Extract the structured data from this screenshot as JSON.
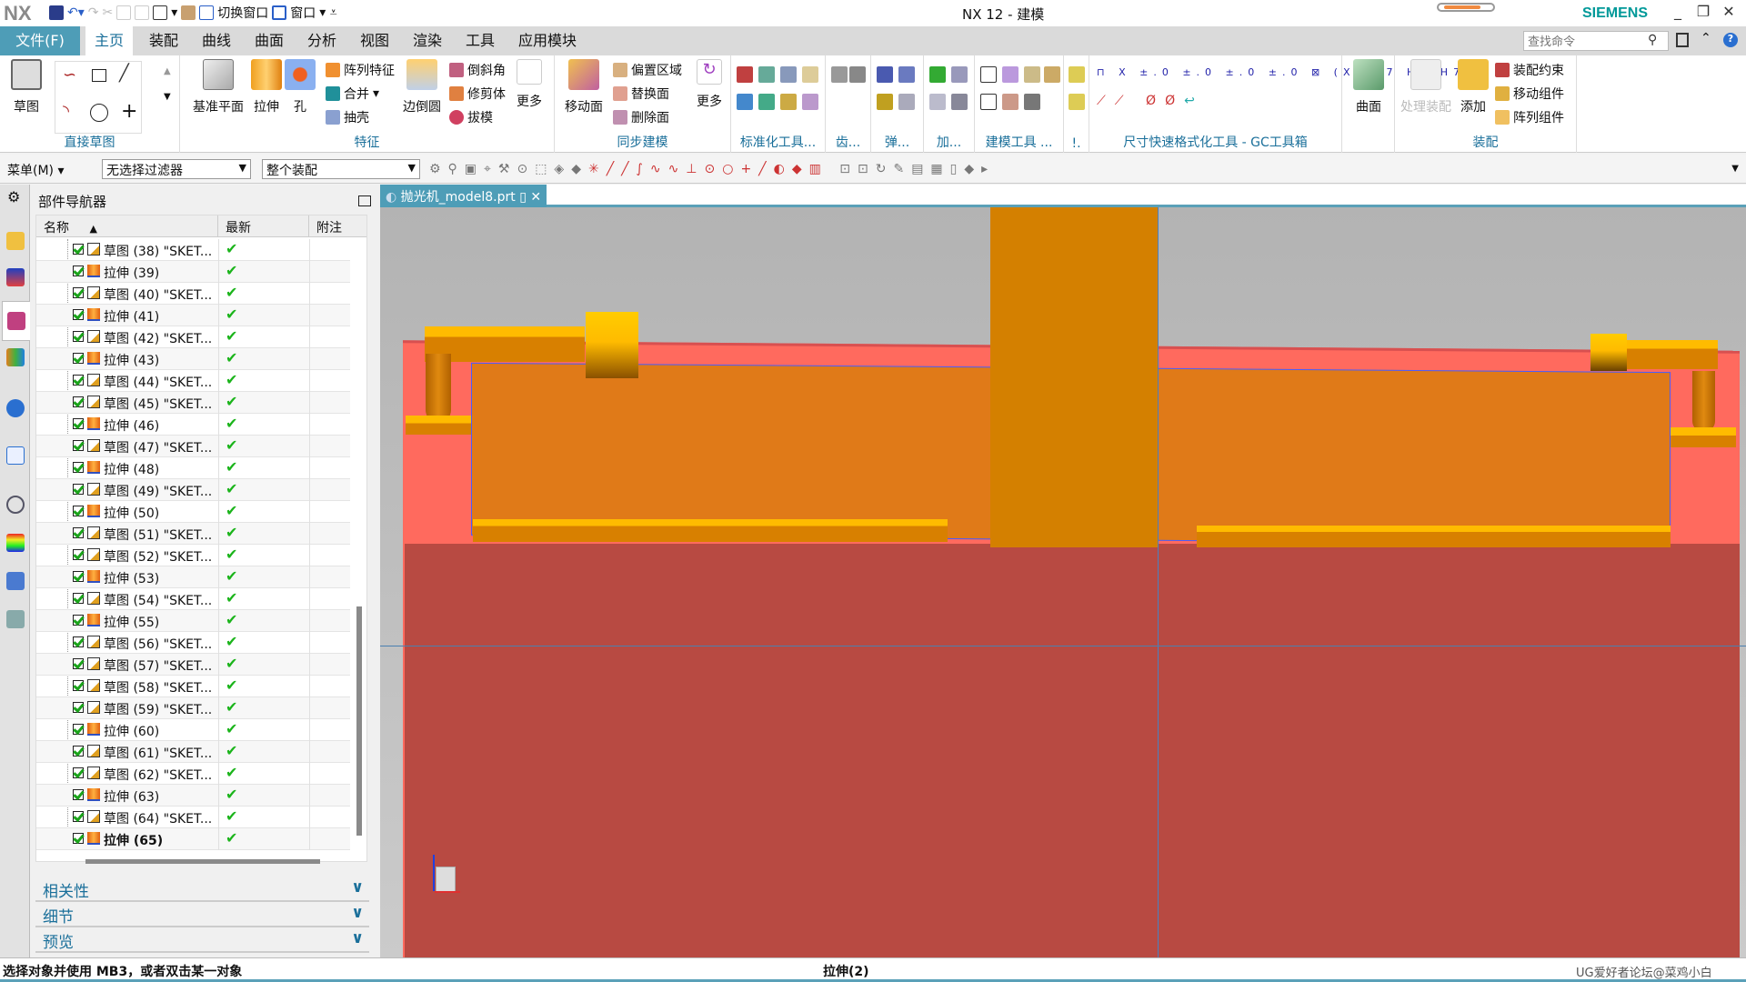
{
  "app": {
    "logo": "NX",
    "title": "NX 12 - 建模",
    "brand": "SIEMENS",
    "switch_window": "切换窗口",
    "window": "窗口"
  },
  "tabs": [
    "文件(F)",
    "主页",
    "装配",
    "曲线",
    "曲面",
    "分析",
    "视图",
    "渲染",
    "工具",
    "应用模块"
  ],
  "active_tab": "主页",
  "search": {
    "placeholder": "查找命令"
  },
  "ribbon": {
    "direct_sketch": {
      "label": "直接草图",
      "sketch": "草图"
    },
    "feature": {
      "label": "特征",
      "datum_plane": "基准平面",
      "extrude": "拉伸",
      "hole": "孔",
      "pattern_feature": "阵列特征",
      "unite": "合并",
      "shell": "抽壳",
      "edge_blend": "边倒圆",
      "chamfer": "倒斜角",
      "trim_body": "修剪体",
      "draft": "拔模",
      "more": "更多"
    },
    "sync": {
      "label": "同步建模",
      "move_face": "移动面",
      "offset_region": "偏置区域",
      "replace_face": "替换面",
      "delete_face": "删除面",
      "more": "更多"
    },
    "std_tools": "标准化工具...",
    "gear": "齿...",
    "spring": "弹...",
    "machining": "加...",
    "modeling_tools": "建模工具 ...",
    "misc": "!.",
    "gc": "尺寸快速格式化工具 - GC工具箱",
    "surface": "曲面",
    "assembly": {
      "label": "装配",
      "process": "处理装配",
      "add": "添加",
      "constraint": "装配约束",
      "move_component": "移动组件",
      "pattern_component": "阵列组件"
    }
  },
  "toolbar2": {
    "menu": "菜单(M)",
    "filter": "无选择过滤器",
    "scope": "整个装配"
  },
  "navigator": {
    "title": "部件导航器",
    "columns": [
      "名称",
      "最新",
      "附注"
    ],
    "rows": [
      {
        "name": "草图 (38) \"SKET...",
        "type": "sketch"
      },
      {
        "name": "拉伸 (39)",
        "type": "extrude"
      },
      {
        "name": "草图 (40) \"SKET...",
        "type": "sketch"
      },
      {
        "name": "拉伸 (41)",
        "type": "extrude"
      },
      {
        "name": "草图 (42) \"SKET...",
        "type": "sketch"
      },
      {
        "name": "拉伸 (43)",
        "type": "extrude"
      },
      {
        "name": "草图 (44) \"SKET...",
        "type": "sketch"
      },
      {
        "name": "草图 (45) \"SKET...",
        "type": "sketch"
      },
      {
        "name": "拉伸 (46)",
        "type": "extrude"
      },
      {
        "name": "草图 (47) \"SKET...",
        "type": "sketch"
      },
      {
        "name": "拉伸 (48)",
        "type": "extrude"
      },
      {
        "name": "草图 (49) \"SKET...",
        "type": "sketch"
      },
      {
        "name": "拉伸 (50)",
        "type": "extrude"
      },
      {
        "name": "草图 (51) \"SKET...",
        "type": "sketch"
      },
      {
        "name": "草图 (52) \"SKET...",
        "type": "sketch"
      },
      {
        "name": "拉伸 (53)",
        "type": "extrude"
      },
      {
        "name": "草图 (54) \"SKET...",
        "type": "sketch"
      },
      {
        "name": "拉伸 (55)",
        "type": "extrude"
      },
      {
        "name": "草图 (56) \"SKET...",
        "type": "sketch"
      },
      {
        "name": "草图 (57) \"SKET...",
        "type": "sketch"
      },
      {
        "name": "草图 (58) \"SKET...",
        "type": "sketch"
      },
      {
        "name": "草图 (59) \"SKET...",
        "type": "sketch"
      },
      {
        "name": "拉伸 (60)",
        "type": "extrude"
      },
      {
        "name": "草图 (61) \"SKET...",
        "type": "sketch"
      },
      {
        "name": "草图 (62) \"SKET...",
        "type": "sketch"
      },
      {
        "name": "拉伸 (63)",
        "type": "extrude"
      },
      {
        "name": "草图 (64) \"SKET...",
        "type": "sketch"
      },
      {
        "name": "拉伸 (65)",
        "type": "extrude",
        "current": true
      }
    ],
    "sections": [
      "相关性",
      "细节",
      "预览"
    ]
  },
  "viewport": {
    "tab": "抛光机_model8.prt"
  },
  "status": {
    "prompt": "选择对象并使用 MB3，或者双击某一对象",
    "selection": "拉伸(2)",
    "watermark": "UG爱好者论坛@菜鸡小白"
  },
  "colors": {
    "accent": "#4e9db7",
    "brand": "#009999",
    "frame_light": "#ff6a5e",
    "frame_dark": "#b84a42",
    "panel": "#e07a18",
    "column": "#d48000",
    "bar_top": "#ffbb00"
  }
}
